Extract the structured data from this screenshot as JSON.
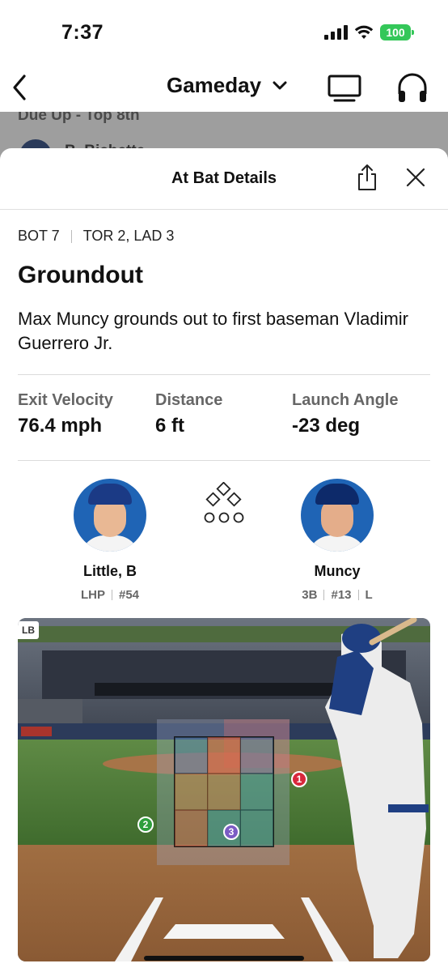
{
  "status_bar": {
    "time": "7:37",
    "battery": "100",
    "colors": {
      "battery": "#34c759"
    }
  },
  "nav": {
    "title": "Gameday",
    "icons": [
      "chevron-left-icon",
      "chevron-down-icon",
      "tv-icon",
      "headphones-icon"
    ]
  },
  "background": {
    "due_up": "Due Up - Top 8th",
    "player_partial": "B. Bichette"
  },
  "sheet": {
    "title": "At Bat Details",
    "inning": "BOT 7",
    "score": "TOR 2, LAD 3",
    "result": "Groundout",
    "description": "Max Muncy grounds out to first baseman Vladimir Guerrero Jr.",
    "stats": [
      {
        "label": "Exit Velocity",
        "value": "76.4 mph"
      },
      {
        "label": "Distance",
        "value": "6 ft"
      },
      {
        "label": "Launch Angle",
        "value": "-23 deg"
      }
    ],
    "pitcher": {
      "name": "Little, B",
      "position": "LHP",
      "number": "#54"
    },
    "batter": {
      "name": "Muncy",
      "position": "3B",
      "number": "#13",
      "bats": "L"
    },
    "scene": {
      "label": "LB",
      "pitches": [
        {
          "number": "1",
          "color": "#d8283c"
        },
        {
          "number": "2",
          "color": "#2e9e3c"
        },
        {
          "number": "3",
          "color": "#7b5cc4"
        }
      ]
    }
  }
}
